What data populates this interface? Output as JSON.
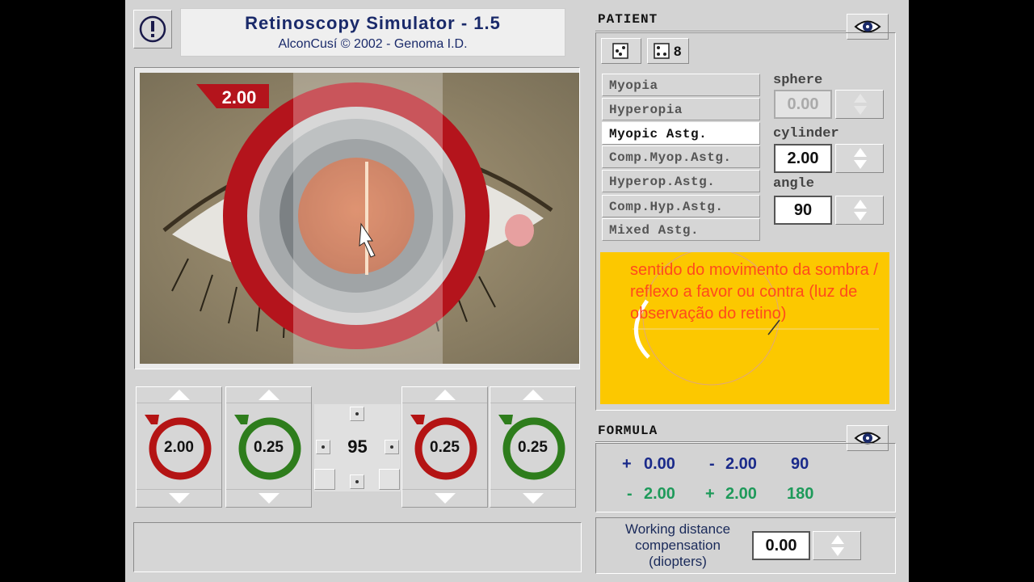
{
  "app": {
    "title": "Retinoscopy Simulator - 1.5",
    "subtitle": "AlconCusí © 2002 - Genoma I.D."
  },
  "viewer": {
    "ring_value": "2.00"
  },
  "lens_controls": {
    "left": [
      {
        "value": "2.00",
        "color": "#b41414"
      },
      {
        "value": "0.25",
        "color": "#2e7d1c"
      }
    ],
    "center_value": "95",
    "right": [
      {
        "value": "0.25",
        "color": "#b41414"
      },
      {
        "value": "0.25",
        "color": "#2e7d1c"
      }
    ]
  },
  "patient": {
    "section_title": "PATIENT",
    "dice_count": "8",
    "conditions": [
      {
        "label": "Myopia"
      },
      {
        "label": "Hyperopia"
      },
      {
        "label": "Myopic Astg."
      },
      {
        "label": "Comp.Myop.Astg."
      },
      {
        "label": "Hyperop.Astg."
      },
      {
        "label": "Comp.Hyp.Astg."
      },
      {
        "label": "Mixed Astg."
      }
    ],
    "selected_condition": "Myopic Astg.",
    "sphere": {
      "label": "sphere",
      "value": "0.00"
    },
    "cylinder": {
      "label": "cylinder",
      "value": "2.00"
    },
    "angle": {
      "label": "angle",
      "value": "90"
    }
  },
  "annotation": {
    "text": "sentido do movimento da sombra / reflexo a favor ou contra (luz de observação do retino)",
    "color": "#ff4a1c",
    "background": "#fcc800"
  },
  "formula": {
    "section_title": "FORMULA",
    "row1": {
      "s1": "+",
      "v1": "0.00",
      "s2": "-",
      "v2": "2.00",
      "v3": "90",
      "color": "#1a2a8a"
    },
    "row2": {
      "s1": "-",
      "v1": "2.00",
      "s2": "+",
      "v2": "2.00",
      "v3": "180",
      "color": "#1e9a5a"
    }
  },
  "working_distance": {
    "label": "Working distance compensation (diopters)",
    "value": "0.00"
  }
}
